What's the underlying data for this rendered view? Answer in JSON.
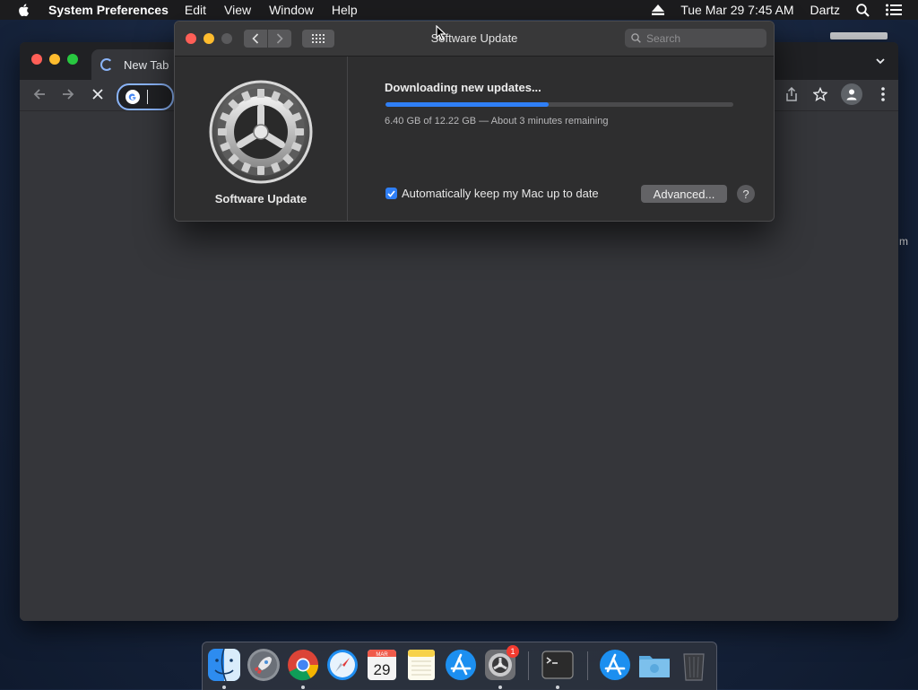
{
  "menubar": {
    "app_name": "System Preferences",
    "menus": [
      "Edit",
      "View",
      "Window",
      "Help"
    ],
    "clock": "Tue Mar 29  7:45 AM",
    "user": "Dartz"
  },
  "browser": {
    "tab_title": "New Tab",
    "peek_text": "m"
  },
  "software_update": {
    "window_title": "Software Update",
    "search_placeholder": "Search",
    "pane_name": "Software Update",
    "status": "Downloading new updates...",
    "progress_fraction": 0.47,
    "progress_text": "6.40 GB of 12.22 GB — About 3 minutes remaining",
    "auto_update_label": "Automatically keep my Mac up to date",
    "auto_update_checked": true,
    "advanced_label": "Advanced...",
    "help_label": "?"
  },
  "dock": {
    "items": [
      {
        "name": "Finder",
        "icon": "finder-icon",
        "running": true
      },
      {
        "name": "Launchpad",
        "icon": "launchpad-icon",
        "running": false
      },
      {
        "name": "Google Chrome",
        "icon": "chrome-icon",
        "running": true
      },
      {
        "name": "Safari",
        "icon": "safari-icon",
        "running": false
      },
      {
        "name": "Calendar",
        "icon": "calendar-icon",
        "running": false,
        "month": "MAR",
        "day": "29"
      },
      {
        "name": "Notes",
        "icon": "notes-icon",
        "running": false
      },
      {
        "name": "App Store",
        "icon": "app-store-icon",
        "running": false
      },
      {
        "name": "System Preferences",
        "icon": "system-preferences-icon",
        "running": true,
        "badge": "1"
      },
      {
        "name": "Terminal",
        "icon": "terminal-icon",
        "running": true
      },
      {
        "name": "Applications",
        "icon": "applications-folder-icon",
        "running": false
      },
      {
        "name": "Downloads",
        "icon": "downloads-folder-icon",
        "running": false
      },
      {
        "name": "Trash",
        "icon": "trash-icon",
        "running": false
      }
    ]
  },
  "colors": {
    "accent": "#2f7ff6",
    "close": "#ff5f57",
    "minimize": "#febc2e",
    "zoom": "#28c840"
  }
}
